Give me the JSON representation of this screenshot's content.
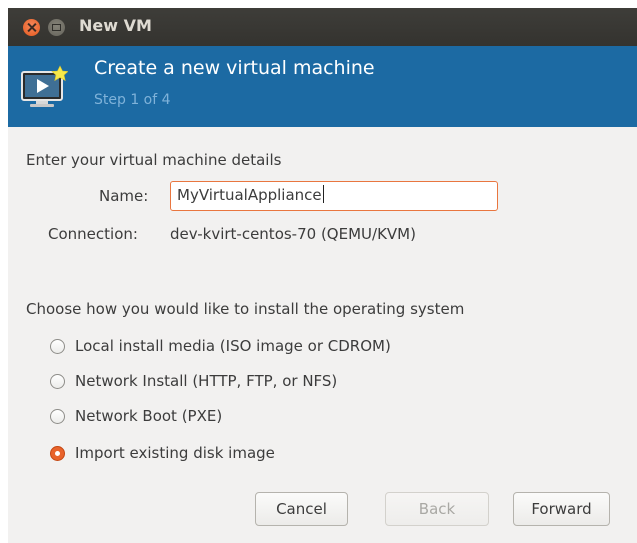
{
  "window": {
    "title": "New VM"
  },
  "banner": {
    "title": "Create a new virtual machine",
    "step": "Step 1 of 4",
    "icon": "virtual-machine-new-icon"
  },
  "details": {
    "heading": "Enter your virtual machine details",
    "name_label": "Name:",
    "name_value": "MyVirtualAppliance",
    "connection_label": "Connection:",
    "connection_value": "dev-kvirt-centos-70 (QEMU/KVM)"
  },
  "install": {
    "heading": "Choose how you would like to install the operating system",
    "options": [
      {
        "label": "Local install media (ISO image or CDROM)",
        "selected": false
      },
      {
        "label": "Network Install (HTTP, FTP, or NFS)",
        "selected": false
      },
      {
        "label": "Network Boot (PXE)",
        "selected": false
      },
      {
        "label": "Import existing disk image",
        "selected": true
      }
    ]
  },
  "buttons": {
    "cancel": "Cancel",
    "back": "Back",
    "forward": "Forward",
    "back_enabled": false
  },
  "colors": {
    "banner": "#1c6aa3",
    "titlebar": "#3a3935",
    "accent": "#e8632b"
  }
}
